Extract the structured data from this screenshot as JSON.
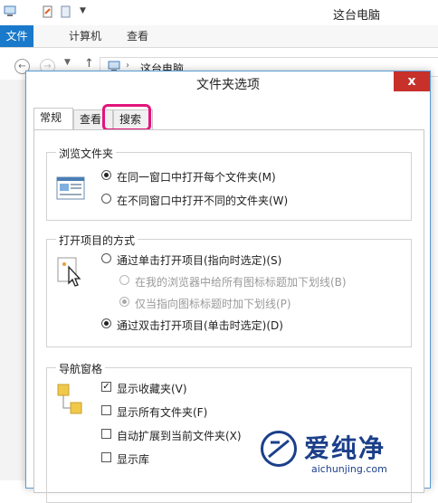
{
  "explorer": {
    "title": "这台电脑",
    "ribbon_tabs": [
      {
        "label": "文件"
      },
      {
        "label": "计算机"
      },
      {
        "label": "查看"
      }
    ],
    "address": "这台电脑",
    "back_arrow": "←",
    "forward_arrow": "→",
    "up_arrow": "↑"
  },
  "dialog": {
    "title": "文件夹选项",
    "close_glyph": "x",
    "tabs": [
      {
        "label": "常规",
        "active": true
      },
      {
        "label": "查看",
        "active": false,
        "highlighted": true
      },
      {
        "label": "搜索",
        "active": false
      }
    ],
    "browse_group": {
      "title": "浏览文件夹",
      "options": [
        {
          "label": "在同一窗口中打开每个文件夹(M)",
          "checked": true
        },
        {
          "label": "在不同窗口中打开不同的文件夹(W)",
          "checked": false
        }
      ]
    },
    "open_group": {
      "title": "打开项目的方式",
      "options": [
        {
          "label": "通过单击打开项目(指向时选定)(S)",
          "checked": false,
          "disabled": false
        },
        {
          "label": "在我的浏览器中给所有图标标题加下划线(B)",
          "checked": false,
          "disabled": true
        },
        {
          "label": "仅当指向图标标题时加下划线(P)",
          "checked": true,
          "disabled": true
        },
        {
          "label": "通过双击打开项目(单击时选定)(D)",
          "checked": true,
          "disabled": false
        }
      ]
    },
    "nav_group": {
      "title": "导航窗格",
      "options": [
        {
          "label": "显示收藏夹(V)",
          "checked": true
        },
        {
          "label": "显示所有文件夹(F)",
          "checked": false
        },
        {
          "label": "自动扩展到当前文件夹(X)",
          "checked": false
        },
        {
          "label": "显示库",
          "checked": false
        }
      ]
    }
  },
  "watermark": {
    "brand": "爱纯净",
    "url": "aichunjing.com"
  },
  "colors": {
    "ribbon_file": "#1979ca",
    "close": "#c7312a",
    "highlight": "#e2157b",
    "dialog_border": "#5b9bd5"
  }
}
